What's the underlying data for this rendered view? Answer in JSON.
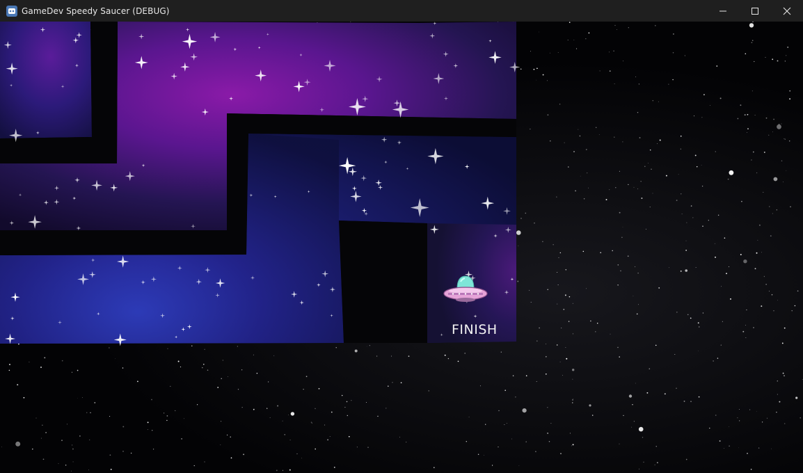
{
  "window": {
    "title": "GameDev Speedy Saucer (DEBUG)",
    "app_icon": "godot-engine-icon",
    "controls": [
      "minimize-icon",
      "maximize-icon",
      "close-icon"
    ]
  },
  "game": {
    "finish_label": "FINISH",
    "player": "ufo-saucer",
    "colors": {
      "space": "#030305",
      "nebula_purple": "#7a1aa0",
      "nebula_blue": "#1a2a8a",
      "saucer_dome": "#7ee6d8",
      "saucer_body": "#e6a3d8"
    }
  }
}
